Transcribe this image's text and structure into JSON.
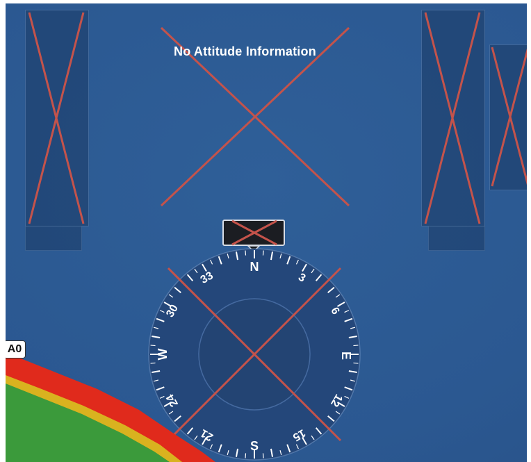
{
  "status": {
    "message": "No Attitude Information"
  },
  "traffic_tag": {
    "label": "A0"
  },
  "compass": {
    "cardinals": [
      "N",
      "E",
      "S",
      "W"
    ],
    "headings": [
      "3",
      "6",
      "12",
      "15",
      "21",
      "24",
      "30",
      "33"
    ]
  },
  "colors": {
    "background": "#2b5891",
    "failure_cross": "#c4534b",
    "terrain_warning": "#e02a1c",
    "terrain_caution": "#d9b21f",
    "terrain_safe": "#3b9a3b"
  },
  "icons": [
    "failure-cross-icon",
    "heading-pointer-icon"
  ]
}
